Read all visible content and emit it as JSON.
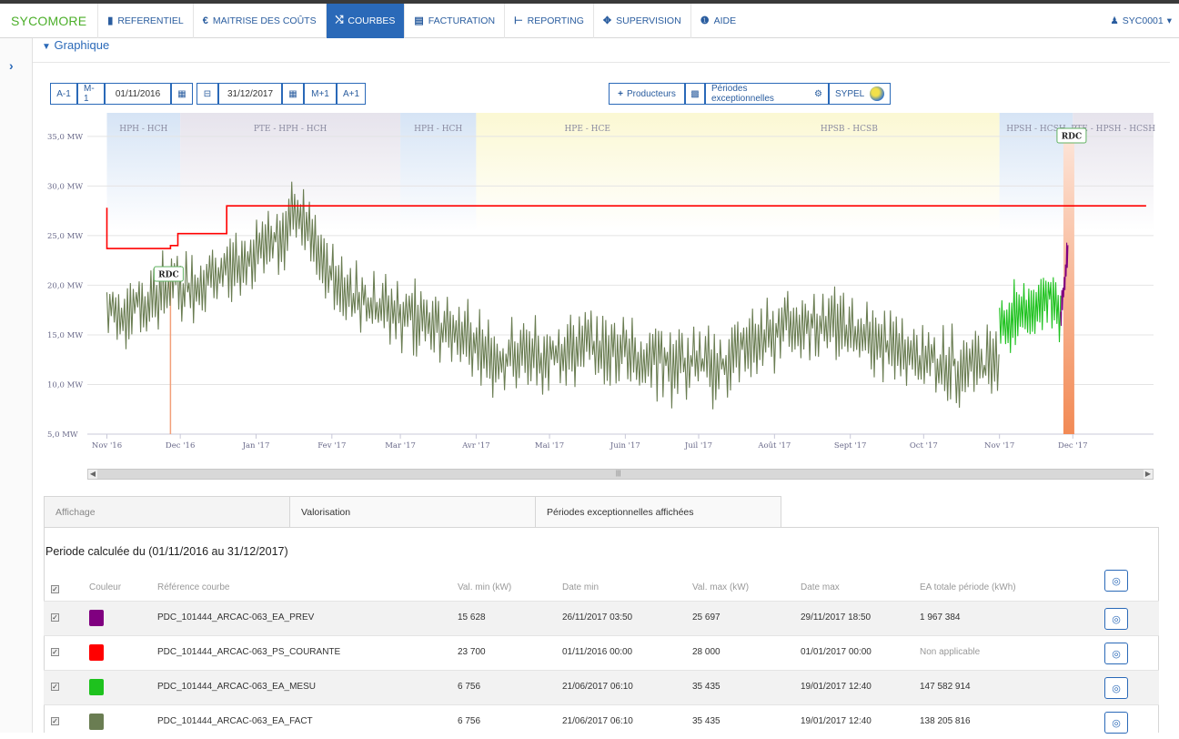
{
  "nav": {
    "brand": "SYCOMORE",
    "items": [
      {
        "icon": "book-icon",
        "glyph": "▮",
        "label": "REFERENTIEL"
      },
      {
        "icon": "euro-icon",
        "glyph": "€",
        "label": "MAITRISE DES COÛTS"
      },
      {
        "icon": "shuffle-icon",
        "glyph": "⤭",
        "label": "COURBES"
      },
      {
        "icon": "invoice-icon",
        "glyph": "▤",
        "label": "FACTURATION"
      },
      {
        "icon": "reporting-icon",
        "glyph": "⊢",
        "label": "REPORTING"
      },
      {
        "icon": "supervision-icon",
        "glyph": "✥",
        "label": "SUPERVISION"
      },
      {
        "icon": "info-icon",
        "glyph": "❶",
        "label": "AIDE"
      }
    ],
    "active_index": 2,
    "user": "SYC0001"
  },
  "section": {
    "title": "Graphique"
  },
  "toolbar": {
    "prev_year": "A-1",
    "prev_month": "M-1",
    "date_start": "01/11/2016",
    "date_end": "31/12/2017",
    "next_month": "M+1",
    "next_year": "A+1",
    "producers": "Producteurs",
    "periods": "Périodes exceptionnelles",
    "sypel": "SYPEL"
  },
  "chart_data": {
    "type": "line",
    "x_range": [
      "2016-10-24",
      "2018-01-03"
    ],
    "ylim": [
      5,
      37
    ],
    "y_ticks": [
      "5,0 MW",
      "10,0 MW",
      "15,0 MW",
      "20,0 MW",
      "25,0 MW",
      "30,0 MW",
      "35,0 MW"
    ],
    "x_ticks": [
      "Nov '16",
      "Dec '16",
      "Jan '17",
      "Fev '17",
      "Mar '17",
      "Avr '17",
      "Mai '17",
      "Juin '17",
      "Juil '17",
      "Août '17",
      "Sept '17",
      "Oct '17",
      "Nov '17",
      "Dec '17"
    ],
    "tariff_bands": [
      {
        "label": "HPH - HCH",
        "from": "2016-11-01",
        "to": "2016-12-01",
        "color": "#d6e4f5"
      },
      {
        "label": "PTE - HPH - HCH",
        "from": "2016-12-01",
        "to": "2017-03-01",
        "color": "#e6e3ec"
      },
      {
        "label": "HPH - HCH",
        "from": "2017-03-01",
        "to": "2017-04-01",
        "color": "#d6e4f5"
      },
      {
        "label": "HPE - HCE",
        "from": "2017-04-01",
        "to": "2017-07-01",
        "color": "#fbf8d3"
      },
      {
        "label": "HPSB - HCSB",
        "from": "2017-07-01",
        "to": "2017-11-01",
        "color": "#fbf8d3"
      },
      {
        "label": "HPSH - HCSH",
        "from": "2017-11-01",
        "to": "2017-12-01",
        "color": "#d6e4f5"
      },
      {
        "label": "PTE - HPSH - HCSH",
        "from": "2017-12-01",
        "to": "2018-01-03",
        "color": "#e6e3ec"
      }
    ],
    "markers": [
      {
        "label": "RDC",
        "date": "2016-11-27"
      },
      {
        "label": "RDC",
        "date": "2017-11-29"
      }
    ],
    "series": [
      {
        "name": "PDC_101444_ARCAC-063_PS_COURANTE",
        "color": "#ff0000",
        "x": [
          "2016-11-01",
          "2016-11-01",
          "2016-11-27",
          "2016-11-27",
          "2016-11-30",
          "2016-11-30",
          "2016-12-20",
          "2016-12-20",
          "2017-12-31"
        ],
        "y": [
          27.8,
          23.7,
          23.7,
          24.0,
          24.0,
          25.2,
          25.2,
          28.0,
          28.0
        ]
      },
      {
        "name": "PDC_101444_ARCAC-063_EA_FACT",
        "color": "#6a7d52",
        "x": [
          "2016-11-01",
          "2016-11-15",
          "2016-11-27",
          "2016-12-10",
          "2016-12-25",
          "2017-01-05",
          "2017-01-19",
          "2017-01-28",
          "2017-02-10",
          "2017-03-01",
          "2017-03-20",
          "2017-04-05",
          "2017-04-25",
          "2017-05-15",
          "2017-06-01",
          "2017-06-21",
          "2017-07-10",
          "2017-07-25",
          "2017-08-10",
          "2017-08-25",
          "2017-09-10",
          "2017-09-25",
          "2017-10-10",
          "2017-10-25",
          "2017-11-01"
        ],
        "y": [
          17,
          18,
          20,
          20,
          22,
          24,
          27,
          22,
          19,
          17,
          16,
          13,
          12.5,
          14,
          13,
          12,
          12,
          14.5,
          16,
          16.5,
          14.5,
          13,
          12,
          12,
          13
        ]
      },
      {
        "name": "PDC_101444_ARCAC-063_EA_MESU",
        "color": "#1ec21e",
        "x": [
          "2017-11-01",
          "2017-11-08",
          "2017-11-15",
          "2017-11-22",
          "2017-11-26"
        ],
        "y": [
          16,
          17,
          18,
          19,
          17
        ]
      },
      {
        "name": "PDC_101444_ARCAC-063_EA_PREV",
        "color": "#800080",
        "x": [
          "2017-11-26",
          "2017-11-27",
          "2017-11-28",
          "2017-11-29"
        ],
        "y": [
          17,
          19,
          21,
          23
        ]
      }
    ]
  },
  "tabs": [
    "Affichage",
    "Valorisation",
    "Périodes exceptionnelles affichées"
  ],
  "period_text": "Periode calculée du (01/11/2016 au 31/12/2017)",
  "table": {
    "headers": [
      "Couleur",
      "Référence courbe",
      "Val. min (kW)",
      "Date min",
      "Val. max (kW)",
      "Date max",
      "EA totale période (kWh)"
    ],
    "rows": [
      {
        "color": "#800080",
        "ref": "PDC_101444_ARCAC-063_EA_PREV",
        "vmin": "15 628",
        "dmin": "26/11/2017 03:50",
        "vmax": "25 697",
        "dmax": "29/11/2017 18:50",
        "ea": "1 967 384"
      },
      {
        "color": "#ff0000",
        "ref": "PDC_101444_ARCAC-063_PS_COURANTE",
        "vmin": "23 700",
        "dmin": "01/11/2016 00:00",
        "vmax": "28 000",
        "dmax": "01/01/2017 00:00",
        "ea": "Non applicable"
      },
      {
        "color": "#1ec21e",
        "ref": "PDC_101444_ARCAC-063_EA_MESU",
        "vmin": "6 756",
        "dmin": "21/06/2017 06:10",
        "vmax": "35 435",
        "dmax": "19/01/2017 12:40",
        "ea": "147 582 914"
      },
      {
        "color": "#6a7d52",
        "ref": "PDC_101444_ARCAC-063_EA_FACT",
        "vmin": "6 756",
        "dmin": "21/06/2017 06:10",
        "vmax": "35 435",
        "dmax": "19/01/2017 12:40",
        "ea": "138 205 816"
      }
    ]
  }
}
